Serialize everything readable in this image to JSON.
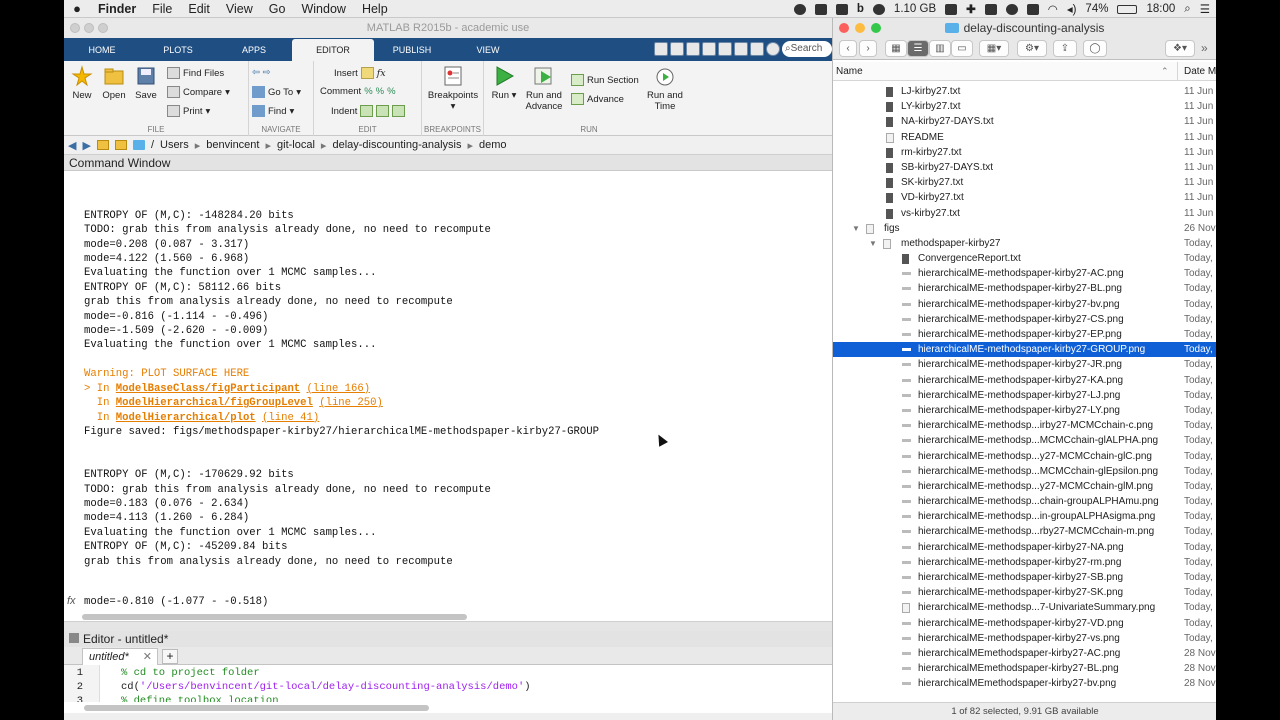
{
  "menubar": {
    "app": "Finder",
    "items": [
      "File",
      "Edit",
      "View",
      "Go",
      "Window",
      "Help"
    ],
    "memory": "1.10 GB",
    "battery": "74%",
    "clock": "18:00"
  },
  "matlab": {
    "title": "MATLAB R2015b - academic use",
    "tabs": [
      "HOME",
      "PLOTS",
      "APPS",
      "EDITOR",
      "PUBLISH",
      "VIEW"
    ],
    "search_placeholder": "Search",
    "ribbon": {
      "file": {
        "new": "New",
        "open": "Open",
        "save": "Save",
        "find_files": "Find Files",
        "compare": "Compare",
        "print": "Print",
        "label": "FILE"
      },
      "navigate": {
        "goto": "Go To",
        "find": "Find",
        "label": "NAVIGATE"
      },
      "edit": {
        "insert": "Insert",
        "comment": "Comment",
        "indent": "Indent",
        "label": "EDIT"
      },
      "breakpoints": {
        "button": "Breakpoints",
        "label": "BREAKPOINTS"
      },
      "run": {
        "run": "Run",
        "run_and_advance": "Run and Advance",
        "run_section": "Run Section",
        "advance": "Advance",
        "run_and_time": "Run and Time",
        "label": "RUN"
      }
    },
    "path": [
      "/",
      "Users",
      "benvincent",
      "git-local",
      "delay-discounting-analysis",
      "demo"
    ],
    "command_window_title": "Command Window",
    "console_lines": [
      {
        "t": "ENTROPY OF (M,C): -148284.20 bits"
      },
      {
        "t": "TODO: grab this from analysis already done, no need to recompute"
      },
      {
        "t": "mode=0.208 (0.087 - 3.317)"
      },
      {
        "t": "mode=4.122 (1.560 - 6.968)"
      },
      {
        "t": "Evaluating the function over 1 MCMC samples..."
      },
      {
        "t": ""
      },
      {
        "t": "ENTROPY OF (M,C): 58112.66 bits"
      },
      {
        "t": "grab this from analysis already done, no need to recompute"
      },
      {
        "t": "mode=-0.816 (-1.114 - -0.496)"
      },
      {
        "t": "mode=-1.509 (-2.620 - -0.009)"
      },
      {
        "t": "Evaluating the function over 1 MCMC samples..."
      }
    ],
    "warning": "Warning: PLOT SURFACE HERE",
    "stack": [
      {
        "prefix": "> In ",
        "fn": "ModelBaseClass/figParticipant",
        "line": "(line 166)"
      },
      {
        "prefix": "  In ",
        "fn": "ModelHierarchical/figGroupLevel",
        "line": "(line 250)"
      },
      {
        "prefix": "  In ",
        "fn": "ModelHierarchical/plot",
        "line": "(line 41)"
      }
    ],
    "figure_saved": "Figure saved: figs/methodspaper-kirby27/hierarchicalME-methodspaper-kirby27-GROUP",
    "console_lines2": [
      {
        "t": "ENTROPY OF (M,C): -170629.92 bits"
      },
      {
        "t": "TODO: grab this from analysis already done, no need to recompute"
      },
      {
        "t": "mode=0.183 (0.076 - 2.634)"
      },
      {
        "t": "mode=4.113 (1.260 - 6.284)"
      },
      {
        "t": "Evaluating the function over 1 MCMC samples..."
      },
      {
        "t": ""
      },
      {
        "t": "ENTROPY OF (M,C): -45209.84 bits"
      },
      {
        "t": "grab this from analysis already done, no need to recompute"
      }
    ],
    "prompt_line": "mode=-0.810 (-1.077 - -0.518)",
    "editor_title": "Editor - untitled*",
    "editor_tab": "untitled*",
    "editor_lines": [
      {
        "n": "1",
        "code": "% cd to project folder",
        "kind": "cm"
      },
      {
        "n": "2",
        "code": "cd('/Users/benvincent/git-local/delay-discounting-analysis/demo')",
        "kind": "mixed"
      },
      {
        "n": "3",
        "code": "% define toolbox location",
        "kind": "cm"
      }
    ]
  },
  "finder": {
    "title": "delay-discounting-analysis",
    "column_name": "Name",
    "column_date": "Date Mo",
    "rows": [
      {
        "name": "LJ-kirby27.txt",
        "date": "11 Jun",
        "kind": "txt",
        "indent": 0
      },
      {
        "name": "LY-kirby27.txt",
        "date": "11 Jun",
        "kind": "txt",
        "indent": 0
      },
      {
        "name": "NA-kirby27-DAYS.txt",
        "date": "11 Jun",
        "kind": "txt",
        "indent": 0
      },
      {
        "name": "README",
        "date": "11 Jun",
        "kind": "doc",
        "indent": 0
      },
      {
        "name": "rm-kirby27.txt",
        "date": "11 Jun",
        "kind": "txt",
        "indent": 0
      },
      {
        "name": "SB-kirby27-DAYS.txt",
        "date": "11 Jun",
        "kind": "txt",
        "indent": 0
      },
      {
        "name": "SK-kirby27.txt",
        "date": "11 Jun",
        "kind": "txt",
        "indent": 0
      },
      {
        "name": "VD-kirby27.txt",
        "date": "11 Jun",
        "kind": "txt",
        "indent": 0
      },
      {
        "name": "vs-kirby27.txt",
        "date": "11 Jun",
        "kind": "txt",
        "indent": 0
      },
      {
        "name": "figs",
        "date": "26 Nov",
        "kind": "folder",
        "indent": -1
      },
      {
        "name": "methodspaper-kirby27",
        "date": "Today,",
        "kind": "folder",
        "indent": -2
      },
      {
        "name": "ConvergenceReport.txt",
        "date": "Today,",
        "kind": "txt",
        "indent": 1
      },
      {
        "name": "hierarchicalME-methodspaper-kirby27-AC.png",
        "date": "Today,",
        "kind": "png",
        "indent": 1
      },
      {
        "name": "hierarchicalME-methodspaper-kirby27-BL.png",
        "date": "Today,",
        "kind": "png",
        "indent": 1
      },
      {
        "name": "hierarchicalME-methodspaper-kirby27-bv.png",
        "date": "Today,",
        "kind": "png",
        "indent": 1
      },
      {
        "name": "hierarchicalME-methodspaper-kirby27-CS.png",
        "date": "Today,",
        "kind": "png",
        "indent": 1
      },
      {
        "name": "hierarchicalME-methodspaper-kirby27-EP.png",
        "date": "Today,",
        "kind": "png",
        "indent": 1
      },
      {
        "name": "hierarchicalME-methodspaper-kirby27-GROUP.png",
        "date": "Today,",
        "kind": "png",
        "indent": 1,
        "selected": true
      },
      {
        "name": "hierarchicalME-methodspaper-kirby27-JR.png",
        "date": "Today,",
        "kind": "png",
        "indent": 1
      },
      {
        "name": "hierarchicalME-methodspaper-kirby27-KA.png",
        "date": "Today,",
        "kind": "png",
        "indent": 1
      },
      {
        "name": "hierarchicalME-methodspaper-kirby27-LJ.png",
        "date": "Today,",
        "kind": "png",
        "indent": 1
      },
      {
        "name": "hierarchicalME-methodspaper-kirby27-LY.png",
        "date": "Today,",
        "kind": "png",
        "indent": 1
      },
      {
        "name": "hierarchicalME-methodsp...irby27-MCMCchain-c.png",
        "date": "Today,",
        "kind": "png",
        "indent": 1
      },
      {
        "name": "hierarchicalME-methodsp...MCMCchain-glALPHA.png",
        "date": "Today,",
        "kind": "png",
        "indent": 1
      },
      {
        "name": "hierarchicalME-methodsp...y27-MCMCchain-glC.png",
        "date": "Today,",
        "kind": "png",
        "indent": 1
      },
      {
        "name": "hierarchicalME-methodsp...MCMCchain-glEpsilon.png",
        "date": "Today,",
        "kind": "png",
        "indent": 1
      },
      {
        "name": "hierarchicalME-methodsp...y27-MCMCchain-glM.png",
        "date": "Today,",
        "kind": "png",
        "indent": 1
      },
      {
        "name": "hierarchicalME-methodsp...chain-groupALPHAmu.png",
        "date": "Today,",
        "kind": "png",
        "indent": 1
      },
      {
        "name": "hierarchicalME-methodsp...in-groupALPHAsigma.png",
        "date": "Today,",
        "kind": "png",
        "indent": 1
      },
      {
        "name": "hierarchicalME-methodsp...rby27-MCMCchain-m.png",
        "date": "Today,",
        "kind": "png",
        "indent": 1
      },
      {
        "name": "hierarchicalME-methodspaper-kirby27-NA.png",
        "date": "Today,",
        "kind": "png",
        "indent": 1
      },
      {
        "name": "hierarchicalME-methodspaper-kirby27-rm.png",
        "date": "Today,",
        "kind": "png",
        "indent": 1
      },
      {
        "name": "hierarchicalME-methodspaper-kirby27-SB.png",
        "date": "Today,",
        "kind": "png",
        "indent": 1
      },
      {
        "name": "hierarchicalME-methodspaper-kirby27-SK.png",
        "date": "Today,",
        "kind": "png",
        "indent": 1
      },
      {
        "name": "hierarchicalME-methodsp...7-UnivariateSummary.png",
        "date": "Today,",
        "kind": "doc",
        "indent": 1
      },
      {
        "name": "hierarchicalME-methodspaper-kirby27-VD.png",
        "date": "Today,",
        "kind": "png",
        "indent": 1
      },
      {
        "name": "hierarchicalME-methodspaper-kirby27-vs.png",
        "date": "Today,",
        "kind": "png",
        "indent": 1
      },
      {
        "name": "hierarchicalMEmethodspaper-kirby27-AC.png",
        "date": "28 Nov",
        "kind": "png",
        "indent": 1
      },
      {
        "name": "hierarchicalMEmethodspaper-kirby27-BL.png",
        "date": "28 Nov",
        "kind": "png",
        "indent": 1
      },
      {
        "name": "hierarchicalMEmethodspaper-kirby27-bv.png",
        "date": "28 Nov",
        "kind": "png",
        "indent": 1
      }
    ],
    "status": "1 of 82 selected, 9.91 GB available"
  }
}
